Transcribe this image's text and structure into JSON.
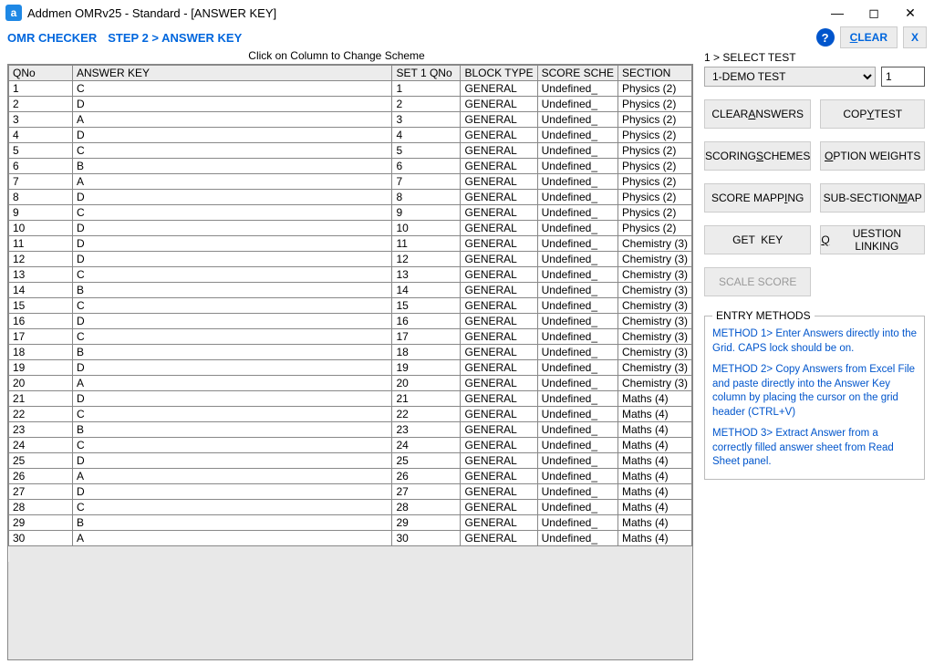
{
  "title": "Addmen OMRv25 - Standard - [ANSWER KEY]",
  "subheader": {
    "left": "OMR CHECKER",
    "step": "STEP 2 > ANSWER KEY"
  },
  "toolbar": {
    "clear": "CLEAR",
    "close": "X"
  },
  "hint": "Click on Column to Change Scheme",
  "grid": {
    "headers": [
      "QNo",
      "ANSWER KEY",
      "SET 1 QNo",
      "BLOCK TYPE",
      "SCORE SCHE",
      "SECTION"
    ],
    "rows": [
      {
        "qno": "1",
        "ans": "C",
        "set": "1",
        "block": "GENERAL",
        "score": "Undefined_",
        "section": "Physics (2)"
      },
      {
        "qno": "2",
        "ans": "D",
        "set": "2",
        "block": "GENERAL",
        "score": "Undefined_",
        "section": "Physics (2)"
      },
      {
        "qno": "3",
        "ans": "A",
        "set": "3",
        "block": "GENERAL",
        "score": "Undefined_",
        "section": "Physics (2)"
      },
      {
        "qno": "4",
        "ans": "D",
        "set": "4",
        "block": "GENERAL",
        "score": "Undefined_",
        "section": "Physics (2)"
      },
      {
        "qno": "5",
        "ans": "C",
        "set": "5",
        "block": "GENERAL",
        "score": "Undefined_",
        "section": "Physics (2)"
      },
      {
        "qno": "6",
        "ans": "B",
        "set": "6",
        "block": "GENERAL",
        "score": "Undefined_",
        "section": "Physics (2)"
      },
      {
        "qno": "7",
        "ans": "A",
        "set": "7",
        "block": "GENERAL",
        "score": "Undefined_",
        "section": "Physics (2)"
      },
      {
        "qno": "8",
        "ans": "D",
        "set": "8",
        "block": "GENERAL",
        "score": "Undefined_",
        "section": "Physics (2)"
      },
      {
        "qno": "9",
        "ans": "C",
        "set": "9",
        "block": "GENERAL",
        "score": "Undefined_",
        "section": "Physics (2)"
      },
      {
        "qno": "10",
        "ans": "D",
        "set": "10",
        "block": "GENERAL",
        "score": "Undefined_",
        "section": "Physics (2)"
      },
      {
        "qno": "11",
        "ans": "D",
        "set": "11",
        "block": "GENERAL",
        "score": "Undefined_",
        "section": "Chemistry (3)"
      },
      {
        "qno": "12",
        "ans": "D",
        "set": "12",
        "block": "GENERAL",
        "score": "Undefined_",
        "section": "Chemistry (3)"
      },
      {
        "qno": "13",
        "ans": "C",
        "set": "13",
        "block": "GENERAL",
        "score": "Undefined_",
        "section": "Chemistry (3)"
      },
      {
        "qno": "14",
        "ans": "B",
        "set": "14",
        "block": "GENERAL",
        "score": "Undefined_",
        "section": "Chemistry (3)"
      },
      {
        "qno": "15",
        "ans": "C",
        "set": "15",
        "block": "GENERAL",
        "score": "Undefined_",
        "section": "Chemistry (3)"
      },
      {
        "qno": "16",
        "ans": "D",
        "set": "16",
        "block": "GENERAL",
        "score": "Undefined_",
        "section": "Chemistry (3)"
      },
      {
        "qno": "17",
        "ans": "C",
        "set": "17",
        "block": "GENERAL",
        "score": "Undefined_",
        "section": "Chemistry (3)"
      },
      {
        "qno": "18",
        "ans": "B",
        "set": "18",
        "block": "GENERAL",
        "score": "Undefined_",
        "section": "Chemistry (3)"
      },
      {
        "qno": "19",
        "ans": "D",
        "set": "19",
        "block": "GENERAL",
        "score": "Undefined_",
        "section": "Chemistry (3)"
      },
      {
        "qno": "20",
        "ans": "A",
        "set": "20",
        "block": "GENERAL",
        "score": "Undefined_",
        "section": "Chemistry (3)"
      },
      {
        "qno": "21",
        "ans": "D",
        "set": "21",
        "block": "GENERAL",
        "score": "Undefined_",
        "section": "Maths (4)"
      },
      {
        "qno": "22",
        "ans": "C",
        "set": "22",
        "block": "GENERAL",
        "score": "Undefined_",
        "section": "Maths (4)"
      },
      {
        "qno": "23",
        "ans": "B",
        "set": "23",
        "block": "GENERAL",
        "score": "Undefined_",
        "section": "Maths (4)"
      },
      {
        "qno": "24",
        "ans": "C",
        "set": "24",
        "block": "GENERAL",
        "score": "Undefined_",
        "section": "Maths (4)"
      },
      {
        "qno": "25",
        "ans": "D",
        "set": "25",
        "block": "GENERAL",
        "score": "Undefined_",
        "section": "Maths (4)"
      },
      {
        "qno": "26",
        "ans": "A",
        "set": "26",
        "block": "GENERAL",
        "score": "Undefined_",
        "section": "Maths (4)"
      },
      {
        "qno": "27",
        "ans": "D",
        "set": "27",
        "block": "GENERAL",
        "score": "Undefined_",
        "section": "Maths (4)"
      },
      {
        "qno": "28",
        "ans": "C",
        "set": "28",
        "block": "GENERAL",
        "score": "Undefined_",
        "section": "Maths (4)"
      },
      {
        "qno": "29",
        "ans": "B",
        "set": "29",
        "block": "GENERAL",
        "score": "Undefined_",
        "section": "Maths (4)"
      },
      {
        "qno": "30",
        "ans": "A",
        "set": "30",
        "block": "GENERAL",
        "score": "Undefined_",
        "section": "Maths (4)"
      }
    ]
  },
  "right": {
    "select_label": "1 > SELECT TEST",
    "test_selected": "1-DEMO TEST",
    "test_num": "1",
    "buttons": {
      "clear_answers": "CLEAR ANSWERS",
      "copy_test": "COPY TEST",
      "scoring_schemes": "SCORING SCHEMES",
      "option_weights": "OPTION WEIGHTS",
      "score_mapping": "SCORE MAPPING",
      "subsection_map": "SUB-SECTION MAP",
      "get_key": "GET  KEY",
      "question_linking": "QUESTION LINKING",
      "scale_score": "SCALE SCORE"
    },
    "entry_legend": "ENTRY METHODS",
    "entry_m1": "METHOD 1> Enter Answers directly into the Grid. CAPS lock should be on.",
    "entry_m2": "METHOD 2> Copy Answers from Excel File and paste directly into the Answer Key column by placing the cursor on the grid header (CTRL+V)",
    "entry_m3": "METHOD 3> Extract Answer from a correctly filled answer sheet from Read Sheet panel."
  }
}
